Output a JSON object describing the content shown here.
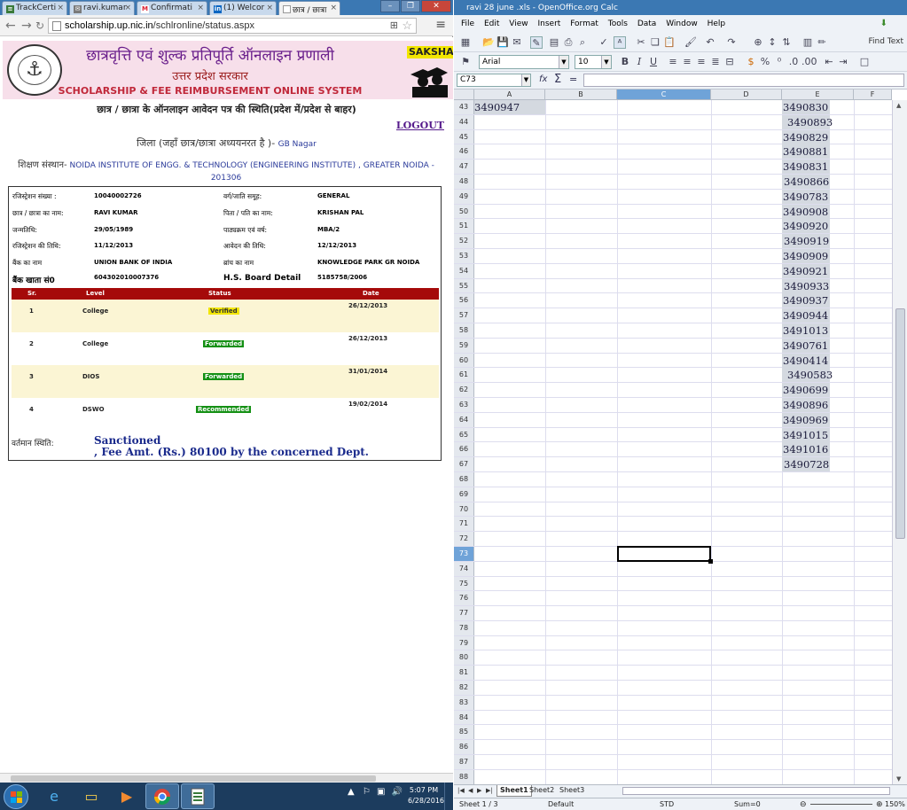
{
  "chrome": {
    "tabs": [
      {
        "label": "TrackCerti"
      },
      {
        "label": "ravi.kumar"
      },
      {
        "label": "Confirmati"
      },
      {
        "label": "(1) Welcor"
      },
      {
        "label": "छात्र / छात्रा"
      }
    ],
    "url_host": "scholarship.up.nic.in",
    "url_path": "/schlronline/status.aspx"
  },
  "portal": {
    "title_hindi": "छात्रवृत्ति एवं शुल्क प्रतिपूर्ति ऑनलाइन प्रणाली",
    "subtitle_hindi": "उत्तर प्रदेश सरकार",
    "title_english": "SCHOLARSHIP & FEE REIMBURSEMENT ONLINE SYSTEM",
    "saksha": "SAKSHA",
    "status_heading": "छात्र / छात्रा के ऑनलाइन आवेदन पत्र की स्थिति(प्रदेश में/प्रदेश से बाहर)",
    "logout": "LOGOUT",
    "district_label": "जिला (जहाँ छात्र/छात्रा अध्ययनरत है )-",
    "district_value": "GB Nagar",
    "institute_label": "शिक्षण संस्थान-",
    "institute_value": "NOIDA INSTITUTE OF ENGG. & TECHNOLOGY (ENGINEERING INSTITUTE) , GREATER NOIDA - 201306",
    "fields": [
      {
        "l": "रजिस्ट्रेशन संख्या :",
        "v": "10040002726",
        "l2": "वर्ग/जाति समूह:",
        "v2": "GENERAL"
      },
      {
        "l": "छात्र / छात्रा का नाम:",
        "v": "RAVI KUMAR",
        "l2": "पिता / पति का नाम:",
        "v2": "KRISHAN PAL"
      },
      {
        "l": "जन्मतिथि:",
        "v": "29/05/1989",
        "l2": "पाठ्यक्रम एवं वर्ष:",
        "v2": "MBA/2"
      },
      {
        "l": "रजिस्ट्रेशन की तिथि:",
        "v": "11/12/2013",
        "l2": "आवेदन की तिथि:",
        "v2": "12/12/2013"
      },
      {
        "l": "बैंक का नाम",
        "v": "UNION BANK OF INDIA",
        "l2": "ब्रांच का नाम",
        "v2": "KNOWLEDGE PARK GR NOIDA"
      },
      {
        "l": "बैंक खाता सं0",
        "v": "604302010007376",
        "l2": "H.S. Board Detail",
        "v2": "5185758/2006"
      }
    ],
    "table_headers": {
      "sr": "Sr.",
      "level": "Level",
      "status": "Status",
      "date": "Date"
    },
    "table_rows": [
      {
        "sr": "1",
        "level": "College",
        "status": "Verified",
        "date": "26/12/2013"
      },
      {
        "sr": "2",
        "level": "College",
        "status": "Forwarded",
        "date": "26/12/2013"
      },
      {
        "sr": "3",
        "level": "DIOS",
        "status": "Forwarded",
        "date": "31/01/2014"
      },
      {
        "sr": "4",
        "level": "DSWO",
        "status": "Recommended",
        "date": "19/02/2014"
      }
    ],
    "current_status_label": "वर्तमान स्थिति:",
    "current_status_line1": "Sanctioned",
    "current_status_line2": ", Fee Amt. (Rs.) 80100 by the concerned Dept."
  },
  "calc": {
    "window_title": "ravi 28 june .xls - OpenOffice.org Calc",
    "menu": [
      "File",
      "Edit",
      "View",
      "Insert",
      "Format",
      "Tools",
      "Data",
      "Window",
      "Help"
    ],
    "font_name": "Arial",
    "font_size": "10",
    "find_text": "Find Text",
    "name_box": "C73",
    "columns": [
      "A",
      "B",
      "C",
      "D",
      "E",
      "F"
    ],
    "rows": [
      {
        "n": "43",
        "a": "3490947",
        "e": "3490830"
      },
      {
        "n": "44",
        "a": "",
        "e": "3490893"
      },
      {
        "n": "45",
        "a": "",
        "e": "3490829"
      },
      {
        "n": "46",
        "a": "",
        "e": "3490881"
      },
      {
        "n": "47",
        "a": "",
        "e": "3490831"
      },
      {
        "n": "48",
        "a": "",
        "e": "3490866"
      },
      {
        "n": "49",
        "a": "",
        "e": "3490783"
      },
      {
        "n": "50",
        "a": "",
        "e": "3490908"
      },
      {
        "n": "51",
        "a": "",
        "e": "3490920"
      },
      {
        "n": "52",
        "a": "",
        "e": "3490919"
      },
      {
        "n": "53",
        "a": "",
        "e": "3490909"
      },
      {
        "n": "54",
        "a": "",
        "e": "3490921"
      },
      {
        "n": "55",
        "a": "",
        "e": "3490933"
      },
      {
        "n": "56",
        "a": "",
        "e": "3490937"
      },
      {
        "n": "57",
        "a": "",
        "e": "3490944"
      },
      {
        "n": "58",
        "a": "",
        "e": "3491013"
      },
      {
        "n": "59",
        "a": "",
        "e": "3490761"
      },
      {
        "n": "60",
        "a": "",
        "e": "3490414"
      },
      {
        "n": "61",
        "a": "",
        "e": "3490583"
      },
      {
        "n": "62",
        "a": "",
        "e": "3490699"
      },
      {
        "n": "63",
        "a": "",
        "e": "3490896"
      },
      {
        "n": "64",
        "a": "",
        "e": "3490969"
      },
      {
        "n": "65",
        "a": "",
        "e": "3491015"
      },
      {
        "n": "66",
        "a": "",
        "e": "3491016"
      },
      {
        "n": "67",
        "a": "",
        "e": "3490728"
      },
      {
        "n": "68",
        "a": "",
        "e": ""
      },
      {
        "n": "69",
        "a": "",
        "e": ""
      },
      {
        "n": "70",
        "a": "",
        "e": ""
      },
      {
        "n": "71",
        "a": "",
        "e": ""
      },
      {
        "n": "72",
        "a": "",
        "e": ""
      },
      {
        "n": "73",
        "a": "",
        "e": ""
      },
      {
        "n": "74",
        "a": "",
        "e": ""
      },
      {
        "n": "75",
        "a": "",
        "e": ""
      },
      {
        "n": "76",
        "a": "",
        "e": ""
      },
      {
        "n": "77",
        "a": "",
        "e": ""
      },
      {
        "n": "78",
        "a": "",
        "e": ""
      },
      {
        "n": "79",
        "a": "",
        "e": ""
      },
      {
        "n": "80",
        "a": "",
        "e": ""
      },
      {
        "n": "81",
        "a": "",
        "e": ""
      },
      {
        "n": "82",
        "a": "",
        "e": ""
      },
      {
        "n": "83",
        "a": "",
        "e": ""
      },
      {
        "n": "84",
        "a": "",
        "e": ""
      },
      {
        "n": "85",
        "a": "",
        "e": ""
      },
      {
        "n": "86",
        "a": "",
        "e": ""
      },
      {
        "n": "87",
        "a": "",
        "e": ""
      },
      {
        "n": "88",
        "a": "",
        "e": ""
      }
    ],
    "sheet_tabs": [
      "Sheet1",
      "Sheet2",
      "Sheet3"
    ],
    "status": {
      "sheet": "Sheet 1 / 3",
      "style": "Default",
      "mode": "STD",
      "sum": "Sum=0",
      "zoom": "150%"
    }
  },
  "taskbar": {
    "time": "5:07 PM",
    "date": "6/28/2016"
  }
}
